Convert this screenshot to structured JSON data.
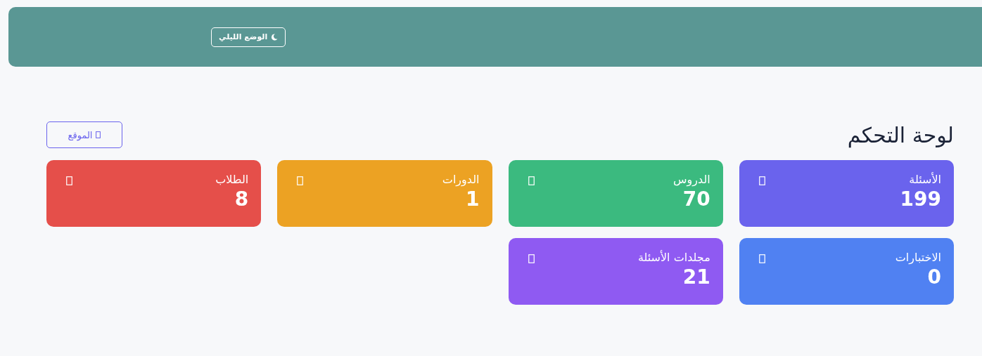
{
  "header": {
    "theme_button": {
      "label": "الوضع الليلي"
    }
  },
  "page": {
    "title": "لوحة التحكم",
    "site_button": {
      "label": "الموقع"
    }
  },
  "stats": [
    {
      "label": "الأسئلة",
      "value": "199",
      "color": "#6a63ed"
    },
    {
      "label": "الدروس",
      "value": "70",
      "color": "#3bba7f"
    },
    {
      "label": "الدورات",
      "value": "1",
      "color": "#eca223"
    },
    {
      "label": "الطلاب",
      "value": "8",
      "color": "#e54f4a"
    },
    {
      "label": "الاختبارات",
      "value": "0",
      "color": "#5081f2"
    },
    {
      "label": "مجلدات الأسئلة",
      "value": "21",
      "color": "#8f5af2"
    }
  ]
}
